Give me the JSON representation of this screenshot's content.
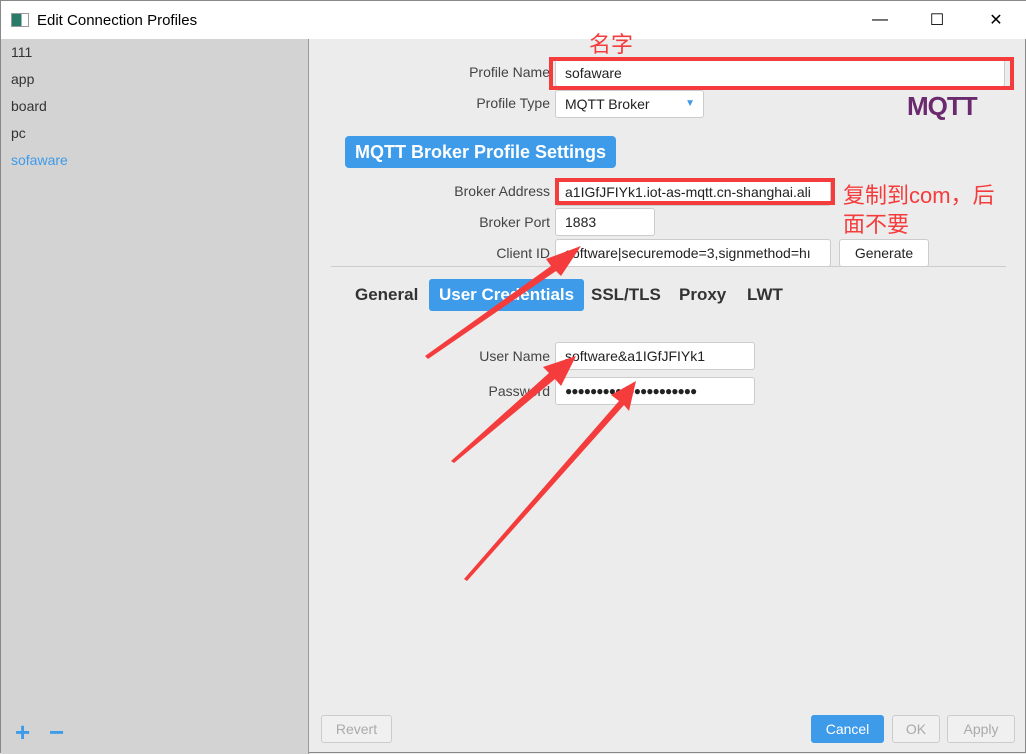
{
  "window": {
    "title": "Edit Connection Profiles",
    "minimize": "—",
    "maximize": "☐",
    "close": "✕"
  },
  "sidebar": {
    "items": [
      {
        "label": "111"
      },
      {
        "label": "app"
      },
      {
        "label": "board"
      },
      {
        "label": "pc"
      },
      {
        "label": "sofaware",
        "selected": true
      }
    ],
    "add": "+",
    "remove": "−"
  },
  "form": {
    "profile_name_label": "Profile Name",
    "profile_name": "sofaware",
    "profile_type_label": "Profile Type",
    "profile_type": "MQTT Broker",
    "logo": "MQTT",
    "section_title": "MQTT Broker Profile Settings",
    "broker_address_label": "Broker Address",
    "broker_address": "a1IGfJFIYk1.iot-as-mqtt.cn-shanghai.ali",
    "broker_port_label": "Broker Port",
    "broker_port": "1883",
    "client_id_label": "Client ID",
    "client_id": "software|securemode=3,signmethod=hı",
    "generate": "Generate"
  },
  "tabs": [
    {
      "label": "General"
    },
    {
      "label": "User Credentials",
      "selected": true
    },
    {
      "label": "SSL/TLS"
    },
    {
      "label": "Proxy"
    },
    {
      "label": "LWT"
    }
  ],
  "credentials": {
    "user_name_label": "User Name",
    "user_name": "software&a1IGfJFIYk1",
    "password_label": "Password",
    "password": "●●●●●●●●●●●●●●●●●●●●●"
  },
  "footer": {
    "revert": "Revert",
    "cancel": "Cancel",
    "ok": "OK",
    "apply": "Apply"
  },
  "annotations": {
    "name_note": "名字",
    "address_note_1": "复制到com，后",
    "address_note_2": "面不要"
  },
  "colors": {
    "accent": "#3d9be9",
    "annotation": "#f53c3c"
  }
}
